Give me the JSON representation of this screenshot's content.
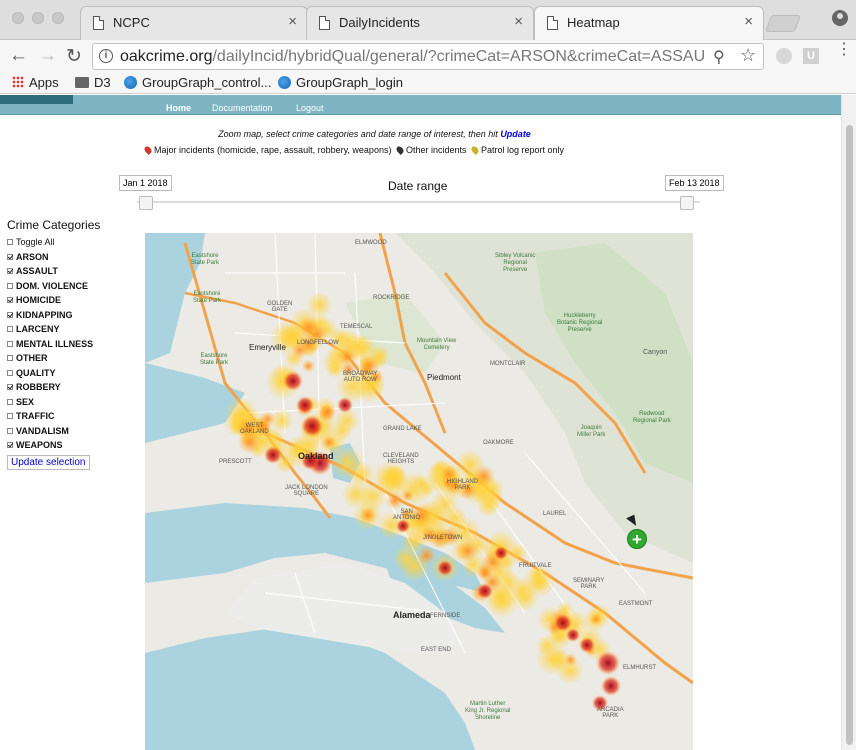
{
  "browser": {
    "tabs": [
      {
        "label": "NCPC",
        "close": "×"
      },
      {
        "label": "DailyIncidents",
        "close": "×"
      },
      {
        "label": "Heatmap",
        "close": "×"
      }
    ],
    "url_domain": "oakcrime.org",
    "url_path": "/dailyIncid/hybridQual/general/?crimeCat=ARSON&crimeCat=ASSAULT&cri...",
    "bookmarks": [
      {
        "label": "Apps",
        "icon": "apps-icon"
      },
      {
        "label": "D3",
        "icon": "folder-icon"
      },
      {
        "label": "GroupGraph_control...",
        "icon": "globe-icon"
      },
      {
        "label": "GroupGraph_login",
        "icon": "globe-icon"
      }
    ],
    "icons": {
      "back": "←",
      "forward": "→",
      "reload": "↻",
      "info": "i",
      "zoom": "⚲",
      "star": "☆",
      "ext_u": "U",
      "menu": "⋮"
    }
  },
  "site_nav": {
    "home": "Home",
    "documentation": "Documentation",
    "logout": "Logout"
  },
  "instructions": {
    "text": "Zoom map, select crime categories and date range of interest, then hit ",
    "link": "Update"
  },
  "legend": {
    "major": "Major incidents (homicide, rape, assault, robbery, weapons)",
    "other": "Other incidents",
    "patrol": "Patrol log report only",
    "colors": {
      "major": "#d13b2f",
      "other": "#333333",
      "patrol": "#c9b12a"
    }
  },
  "date_range": {
    "title": "Date range",
    "start": "Jan 1 2018",
    "end": "Feb 13 2018",
    "slider_start_fraction": 0.0,
    "slider_end_fraction": 1.0
  },
  "categories": {
    "title": "Crime Categories",
    "items": [
      {
        "label": "Toggle All",
        "checked": false,
        "bold": false
      },
      {
        "label": "ARSON",
        "checked": true,
        "bold": true
      },
      {
        "label": "ASSAULT",
        "checked": true,
        "bold": true
      },
      {
        "label": "DOM. VIOLENCE",
        "checked": false,
        "bold": true
      },
      {
        "label": "HOMICIDE",
        "checked": true,
        "bold": true
      },
      {
        "label": "KIDNAPPING",
        "checked": true,
        "bold": true
      },
      {
        "label": "LARCENY",
        "checked": false,
        "bold": true
      },
      {
        "label": "MENTAL ILLNESS",
        "checked": false,
        "bold": true
      },
      {
        "label": "OTHER",
        "checked": false,
        "bold": true
      },
      {
        "label": "QUALITY",
        "checked": false,
        "bold": true
      },
      {
        "label": "ROBBERY",
        "checked": true,
        "bold": true
      },
      {
        "label": "SEX",
        "checked": false,
        "bold": true
      },
      {
        "label": "TRAFFIC",
        "checked": false,
        "bold": true
      },
      {
        "label": "VANDALISM",
        "checked": false,
        "bold": true
      },
      {
        "label": "WEAPONS",
        "checked": true,
        "bold": true
      }
    ],
    "update_button": "Update selection"
  },
  "map": {
    "cities": {
      "oakland": "Oakland",
      "alameda": "Alameda",
      "emeryville": "Emeryville",
      "piedmont": "Piedmont"
    },
    "parks": {
      "sibley": "Sibley Volcanic\nRegional\nPreserve",
      "huckleberry": "Huckleberry\nBotanic Regional\nPreserve",
      "joaquin": "Joaquin\nMiller Park",
      "redwood": "Redwood\nRegional Park",
      "eastshore1": "Eastshore\nState Park",
      "eastshore2": "Eastshore\nState Park",
      "eastshore3": "Eastshore\nState Park",
      "mountainview": "Mountain View\nCemetery",
      "martinluther": "Martin Luther\nKing Jr. Regional\nShoreline"
    },
    "neighborhoods": {
      "elmwood": "ELMWOOD",
      "rockridge": "ROCKRIDGE",
      "temescal": "TEMESCAL",
      "montclair": "MONTCLAIR",
      "canyon": "Canyon",
      "oakmore": "OAKMORE",
      "laurel": "LAUREL",
      "eastmont": "EASTMONT",
      "elmhurst": "ELMHURST",
      "westoakland": "WEST\nOAKLAND",
      "prescott": "PRESCOTT",
      "fruitvale": "FRUITVALE",
      "jingletown": "JINGLETOWN",
      "highland": "HIGHLAND\nPARK",
      "cleveland": "CLEVELAND\nHEIGHTS",
      "grandlake": "GRAND LAKE",
      "eastend": "EAST END",
      "fernside": "FERNSIDE",
      "seminary": "SEMINARY\nPARK",
      "arcadia": "ARCADIA\nPARK",
      "sanantonio": "SAN\nANTONIO",
      "jacklondon": "JACK LONDON\nSQUARE",
      "goldengate": "GOLDEN\nGATE",
      "longfellow": "LONGFELLOW",
      "broadway": "BROADWAY\nAUTO ROW"
    }
  }
}
